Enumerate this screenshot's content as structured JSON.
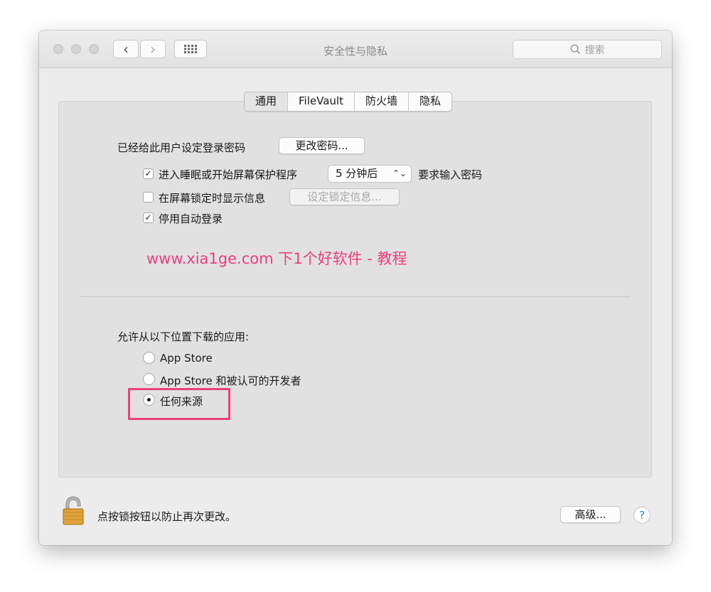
{
  "window": {
    "title": "安全性与隐私",
    "search_placeholder": "搜索",
    "nav_back": "‹",
    "nav_forward": "›"
  },
  "tabs": [
    "通用",
    "FileVault",
    "防火墙",
    "隐私"
  ],
  "active_tab": "通用",
  "general": {
    "password_label": "已经给此用户设定登录密码",
    "change_password_button": "更改密码...",
    "require_password": {
      "checked": true,
      "label": "进入睡眠或开始屏幕保护程序",
      "delay_value": "5 分钟后",
      "suffix": "要求输入密码"
    },
    "show_message": {
      "checked": false,
      "label": "在屏幕锁定时显示信息",
      "button": "设定锁定信息..."
    },
    "disable_autologin": {
      "checked": true,
      "label": "停用自动登录"
    }
  },
  "watermark": "www.xia1ge.com 下1个好软件 - 教程",
  "downloads": {
    "heading": "允许从以下位置下载的应用:",
    "options": [
      "App Store",
      "App Store 和被认可的开发者",
      "任何来源"
    ],
    "selected": "任何来源"
  },
  "footer": {
    "lock_text": "点按锁按钮以防止再次更改。",
    "advanced_button": "高级...",
    "help_button": "?"
  },
  "colors": {
    "highlight": "#e8417d",
    "watermark": "#ea3e7e"
  }
}
